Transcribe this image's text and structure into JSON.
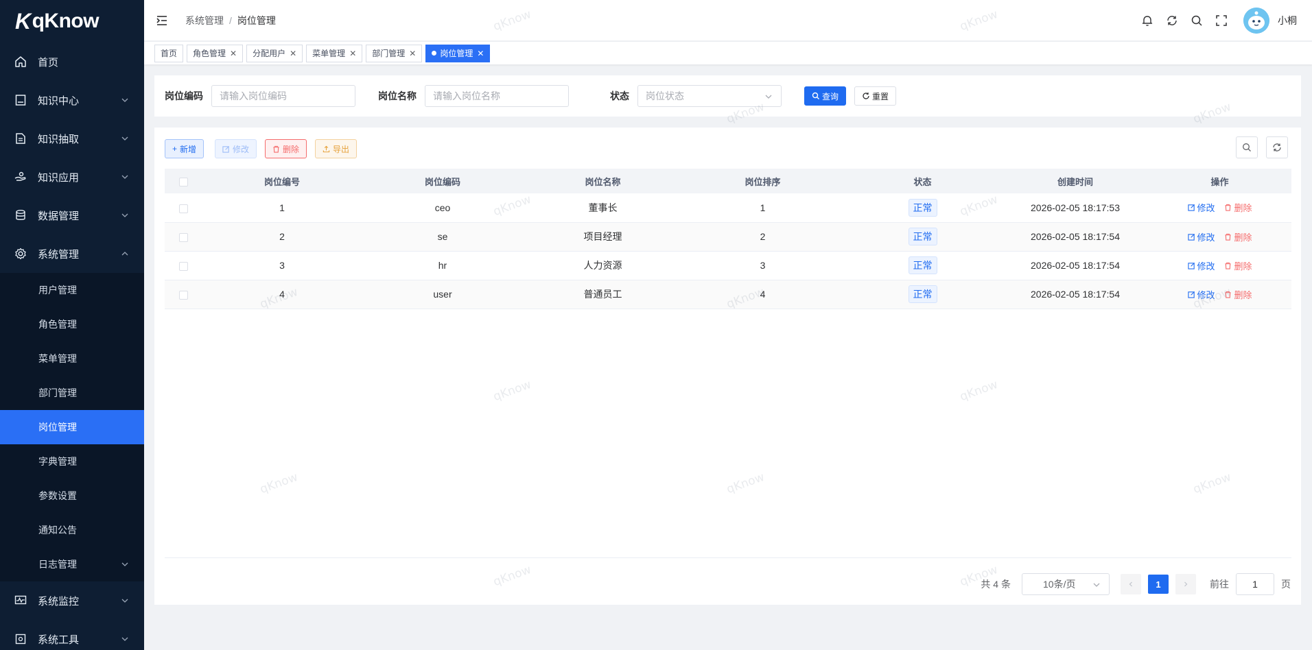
{
  "app": {
    "logo_text": "qKnow",
    "logo_mark": "K"
  },
  "sidebar": {
    "items": [
      {
        "label": "首页",
        "icon": "home-icon"
      },
      {
        "label": "知识中心",
        "icon": "book-icon"
      },
      {
        "label": "知识抽取",
        "icon": "document-icon"
      },
      {
        "label": "知识应用",
        "icon": "hand-icon"
      },
      {
        "label": "数据管理",
        "icon": "database-icon"
      },
      {
        "label": "系统管理",
        "icon": "gear-icon"
      }
    ],
    "sub_items": [
      "用户管理",
      "角色管理",
      "菜单管理",
      "部门管理",
      "岗位管理",
      "字典管理",
      "参数设置",
      "通知公告",
      "日志管理"
    ],
    "bottom_items": [
      {
        "label": "系统监控",
        "icon": "monitor-icon"
      },
      {
        "label": "系统工具",
        "icon": "tools-icon"
      }
    ]
  },
  "header": {
    "breadcrumb": [
      "系统管理",
      "岗位管理"
    ],
    "separator": "/",
    "username": "小桐"
  },
  "tags": [
    "首页",
    "角色管理",
    "分配用户",
    "菜单管理",
    "部门管理",
    "岗位管理"
  ],
  "search": {
    "code_label": "岗位编码",
    "code_placeholder": "请输入岗位编码",
    "name_label": "岗位名称",
    "name_placeholder": "请输入岗位名称",
    "status_label": "状态",
    "status_placeholder": "岗位状态",
    "query_label": "查询",
    "reset_label": "重置"
  },
  "toolbar": {
    "add": "新增",
    "edit": "修改",
    "delete": "删除",
    "export": "导出"
  },
  "table": {
    "columns": [
      "岗位编号",
      "岗位编码",
      "岗位名称",
      "岗位排序",
      "状态",
      "创建时间",
      "操作"
    ],
    "rows": [
      {
        "id": "1",
        "code": "ceo",
        "name": "董事长",
        "sort": "1",
        "status": "正常",
        "created": "2026-02-05 18:17:53"
      },
      {
        "id": "2",
        "code": "se",
        "name": "项目经理",
        "sort": "2",
        "status": "正常",
        "created": "2026-02-05 18:17:54"
      },
      {
        "id": "3",
        "code": "hr",
        "name": "人力资源",
        "sort": "3",
        "status": "正常",
        "created": "2026-02-05 18:17:54"
      },
      {
        "id": "4",
        "code": "user",
        "name": "普通员工",
        "sort": "4",
        "status": "正常",
        "created": "2026-02-05 18:17:54"
      }
    ],
    "op_edit": "修改",
    "op_delete": "删除"
  },
  "pagination": {
    "total_text": "共 4 条",
    "page_size": "10条/页",
    "current_page": "1",
    "goto_label": "前往",
    "goto_value": "1",
    "page_suffix": "页"
  },
  "watermark": "qKnow",
  "colors": {
    "primary": "#1f6bf0",
    "sidebar": "#0e1e33",
    "danger": "#f56c6c",
    "warning": "#e6a23c"
  }
}
